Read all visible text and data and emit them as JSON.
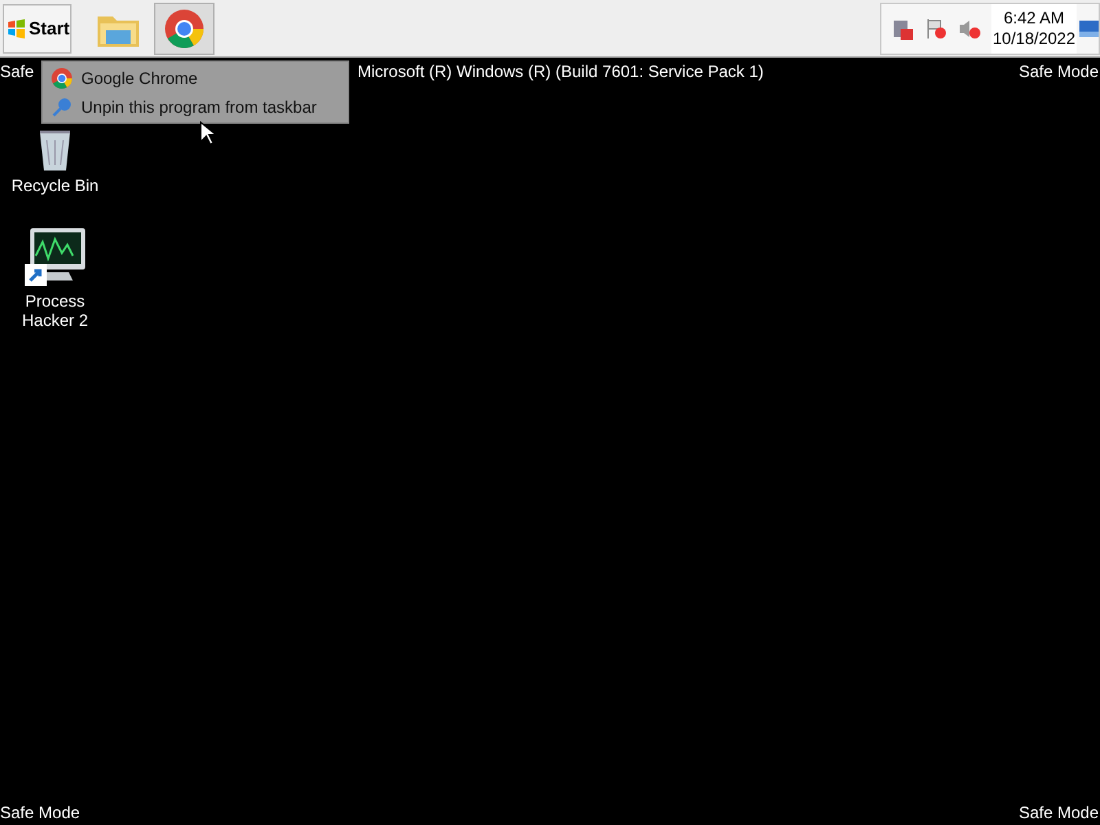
{
  "taskbar": {
    "start_button": "Start",
    "pinned": [
      {
        "kind": "folder",
        "selected": false
      },
      {
        "kind": "browser",
        "selected": true
      }
    ],
    "clock": {
      "time": "6:42 AM",
      "date": "10/18/2022"
    }
  },
  "desktop": {
    "build_text": "Microsoft (R) Windows (R) (Build 7601: Service Pack 1)",
    "corner_labels": {
      "top_left": "Safe",
      "top_right": "Safe Mode",
      "bottom_left": "Safe Mode",
      "bottom_right": "Safe Mode"
    },
    "icons": [
      {
        "kind": "recycle",
        "label": "Recycle Bin"
      },
      {
        "kind": "monitor",
        "label": "Process Hacker 2"
      }
    ]
  },
  "context_menu": {
    "items": [
      {
        "kind": "browser",
        "label": "Google Chrome"
      },
      {
        "kind": "pin",
        "label": "Unpin this program from taskbar"
      }
    ]
  }
}
